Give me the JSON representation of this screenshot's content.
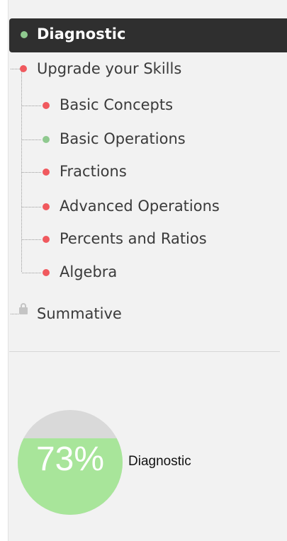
{
  "nav": {
    "diagnostic": "Diagnostic",
    "upgrade": "Upgrade your Skills",
    "skills": [
      "Basic Concepts",
      "Basic Operations",
      "Fractions",
      "Advanced Operations",
      "Percents and Ratios",
      "Algebra"
    ],
    "summative": "Summative"
  },
  "status_colors": {
    "complete": "#8fc98f",
    "incomplete": "#f0595e",
    "locked": "#c4c4c4"
  },
  "progress": {
    "percent": 73,
    "percent_label": "73%",
    "label": "Diagnostic"
  }
}
